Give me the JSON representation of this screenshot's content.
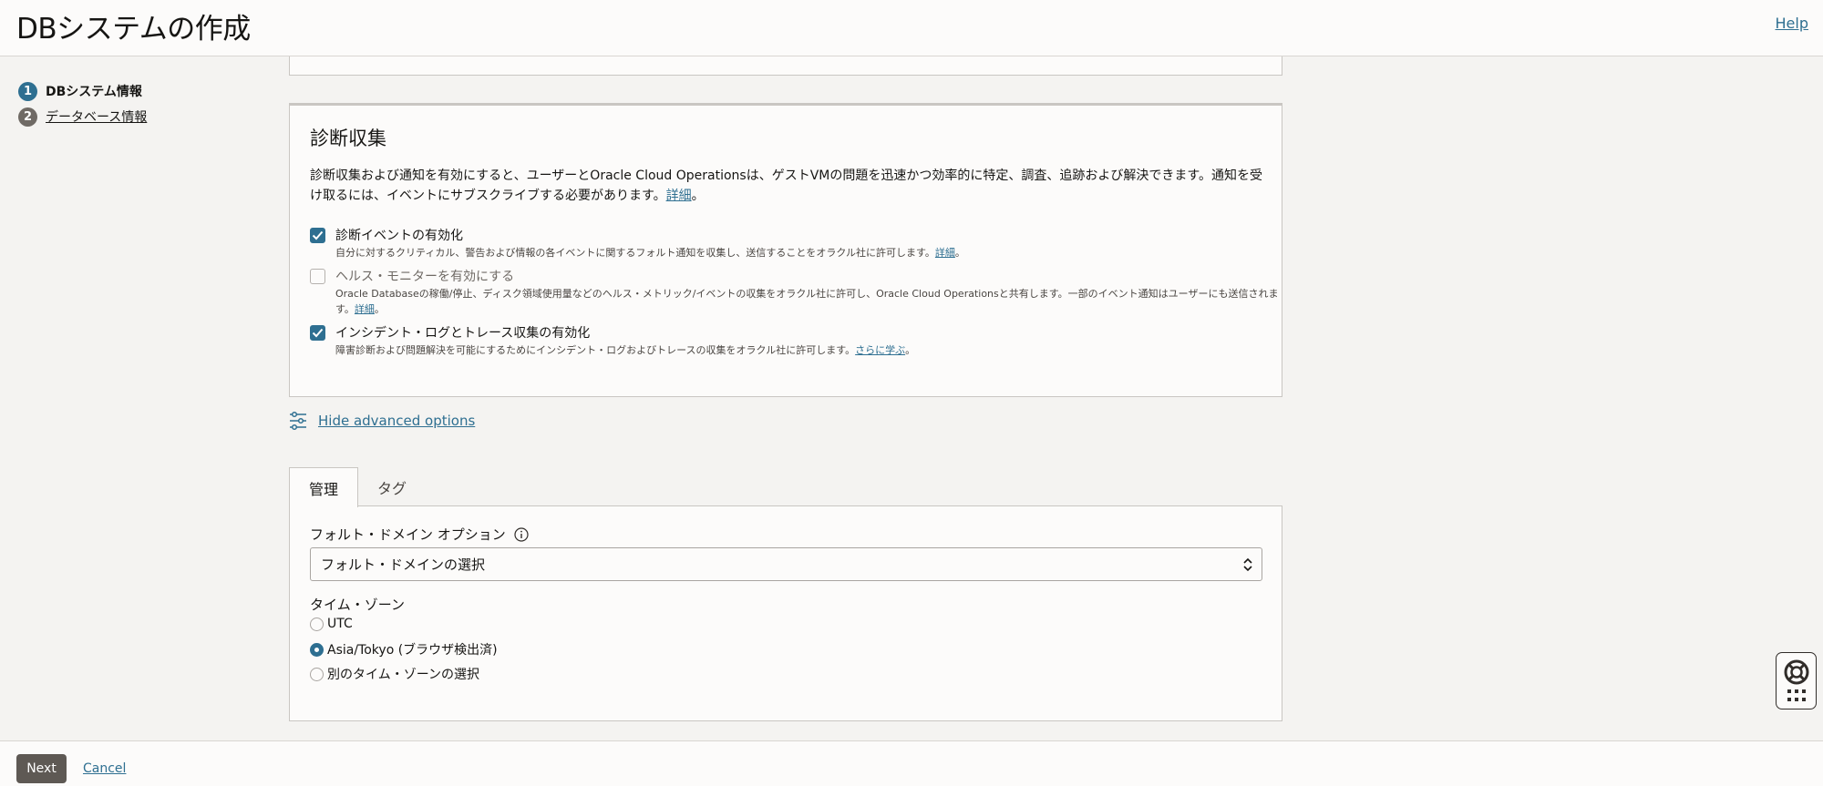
{
  "header": {
    "title": "DBシステムの作成",
    "help_label": "Help"
  },
  "steps": [
    {
      "number": "1",
      "label": "DBシステム情報"
    },
    {
      "number": "2",
      "label": "データベース情報"
    }
  ],
  "diagnostics": {
    "title": "診断収集",
    "description": "診断収集および通知を有効にすると、ユーザーとOracle Cloud Operationsは、ゲストVMの問題を迅速かつ効率的に特定、調査、追跡および解決できます。通知を受け取るには、イベントにサブスクライブする必要があります。",
    "description_link": "詳細",
    "period": "。",
    "options": [
      {
        "label": "診断イベントの有効化",
        "checked": true,
        "disabled": false,
        "help": "自分に対するクリティカル、警告および情報の各イベントに関するフォルト通知を収集し、送信することをオラクル社に許可します。",
        "link": "詳細"
      },
      {
        "label": "ヘルス・モニターを有効にする",
        "checked": false,
        "disabled": true,
        "help": "Oracle Databaseの稼働/停止、ディスク領域使用量などのヘルス・メトリック/イベントの収集をオラクル社に許可し、Oracle Cloud Operationsと共有します。一部のイベント通知はユーザーにも送信されます。",
        "link": "詳細"
      },
      {
        "label": "インシデント・ログとトレース収集の有効化",
        "checked": true,
        "disabled": false,
        "help": "障害診断および問題解決を可能にするためにインシデント・ログおよびトレースの収集をオラクル社に許可します。",
        "link": "さらに学ぶ"
      }
    ]
  },
  "advanced": {
    "toggle_label": "Hide advanced options"
  },
  "tabs": [
    {
      "label": "管理",
      "active": true
    },
    {
      "label": "タグ",
      "active": false
    }
  ],
  "management": {
    "fault_domain_label": "フォルト・ドメイン オプション",
    "fault_domain_value": "フォルト・ドメインの選択",
    "timezone_label": "タイム・ゾーン",
    "timezone_options": [
      {
        "label": "UTC",
        "selected": false
      },
      {
        "label": "Asia/Tokyo (ブラウザ検出済)",
        "selected": true
      },
      {
        "label": "別のタイム・ゾーンの選択",
        "selected": false
      }
    ]
  },
  "footer": {
    "next_label": "Next",
    "cancel_label": "Cancel"
  },
  "colors": {
    "accent": "#2e6f91",
    "button": "#5e5954",
    "background": "#f4f3f1",
    "card": "#fcfbfa"
  }
}
